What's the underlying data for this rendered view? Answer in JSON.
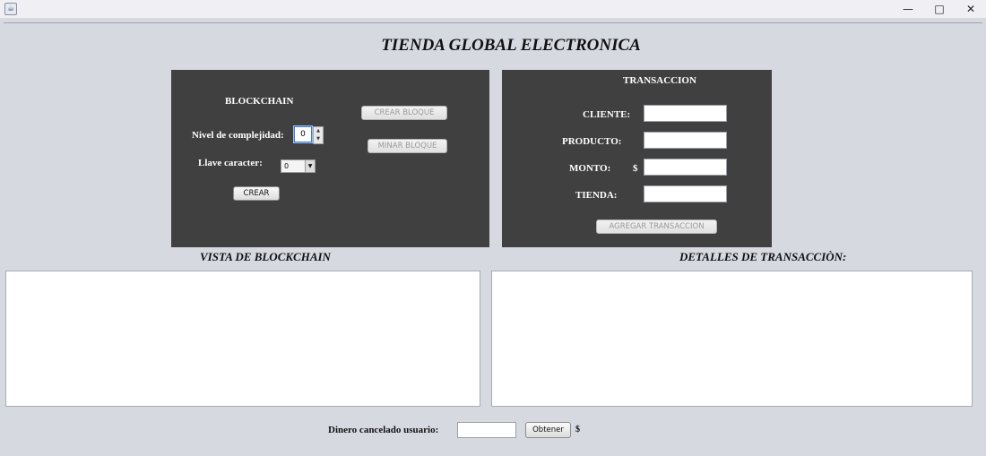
{
  "window": {
    "minimize_glyph": "—",
    "maximize_glyph": "□",
    "close_glyph": "✕",
    "app_icon": "java-icon"
  },
  "title": "TIENDA GLOBAL ELECTRONICA",
  "blockchain_panel": {
    "heading": "BLOCKCHAIN",
    "complexity_label": "Nivel de complejidad:",
    "complexity_value": "0",
    "key_label": "Llave caracter:",
    "key_value": "0",
    "create_button": "CREAR",
    "create_block_button": "CREAR BLOQUE",
    "mine_block_button": "MINAR BLOQUE"
  },
  "transaction_panel": {
    "heading": "TRANSACCION",
    "client_label": "CLIENTE:",
    "product_label": "PRODUCTO:",
    "amount_label": "MONTO:",
    "currency_symbol": "$",
    "store_label": "TIENDA:",
    "add_button": "AGREGAR TRANSACCION"
  },
  "blockchain_view_title": "VISTA DE BLOCKCHAIN",
  "transaction_details_title": "DETALLES DE TRANSACCIÒN:",
  "footer": {
    "cancelled_label": "Dinero cancelado usuario:",
    "obtain_button": "Obtener",
    "currency_symbol": "$"
  },
  "colors": {
    "panel_bg": "#404040",
    "window_bg": "#d6d9e0",
    "focus_border": "#3d7cd6"
  }
}
